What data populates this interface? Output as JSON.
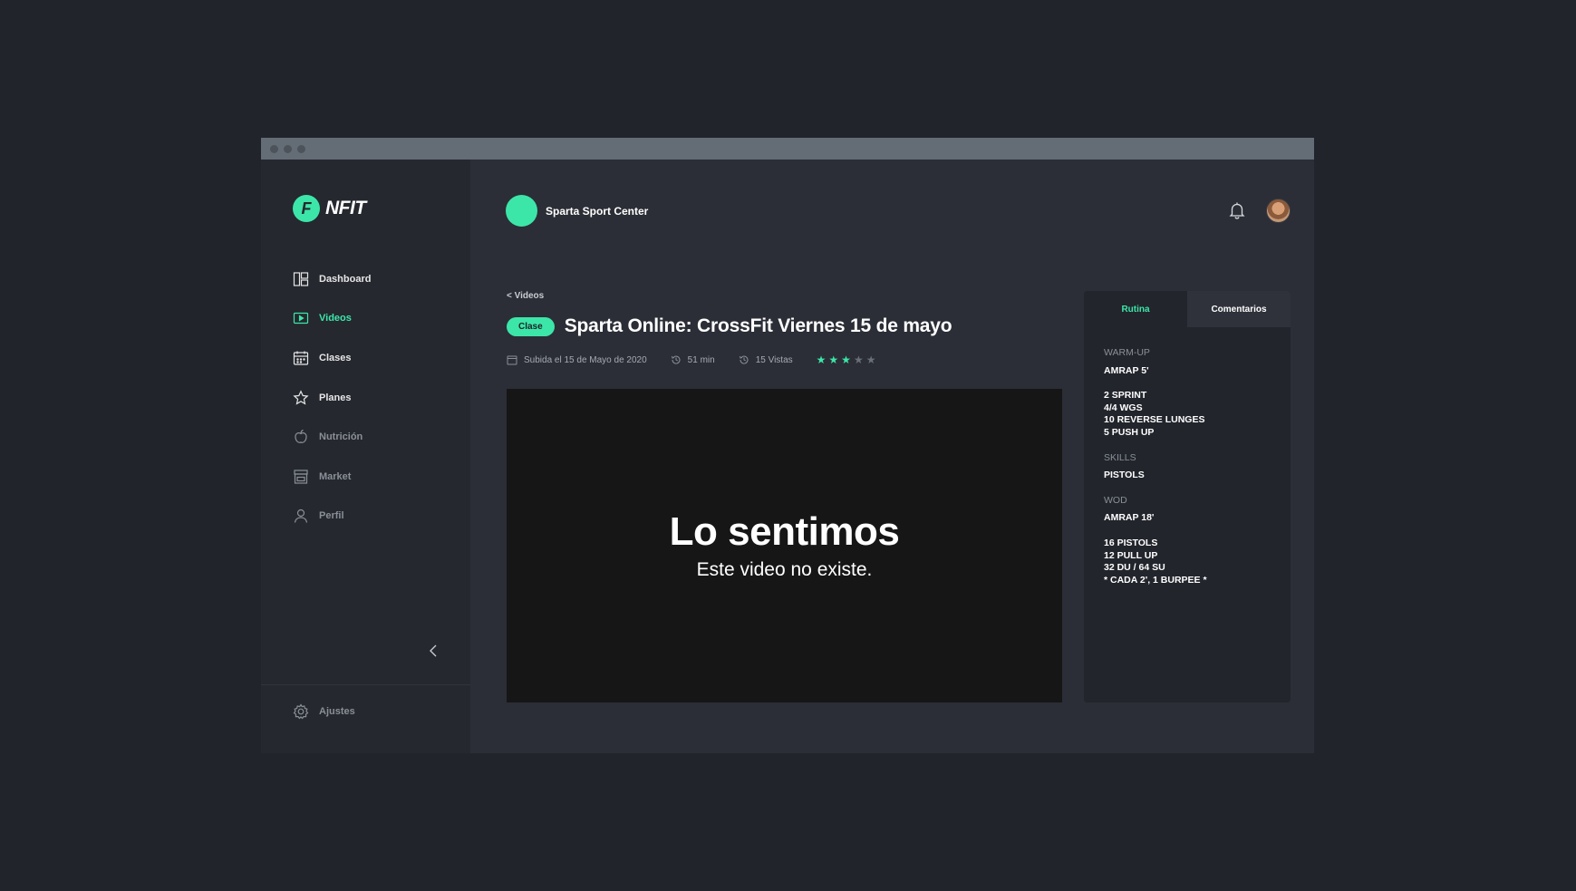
{
  "app": {
    "logo_text": "NFIT",
    "logo_mark": "F"
  },
  "sidebar": {
    "items": [
      {
        "label": "Dashboard",
        "icon": "dashboard-icon"
      },
      {
        "label": "Videos",
        "icon": "video-icon"
      },
      {
        "label": "Clases",
        "icon": "calendar-icon"
      },
      {
        "label": "Planes",
        "icon": "star-icon"
      },
      {
        "label": "Nutrición",
        "icon": "apple-icon"
      },
      {
        "label": "Market",
        "icon": "store-icon"
      },
      {
        "label": "Perfil",
        "icon": "user-icon"
      }
    ],
    "settings_label": "Ajustes"
  },
  "header": {
    "gym_name": "Sparta Sport Center"
  },
  "video": {
    "breadcrumb": "< Videos",
    "badge": "Clase",
    "title": "Sparta Online: CrossFit Viernes 15 de mayo",
    "uploaded": "Subida el 15 de Mayo de 2020",
    "duration": "51 min",
    "views": "15 Vistas",
    "rating": 3,
    "rating_max": 5,
    "error_heading": "Lo sentimos",
    "error_message": "Este video no existe."
  },
  "panel": {
    "tabs": [
      "Rutina",
      "Comentarios"
    ],
    "sections": [
      {
        "label": "WARM-UP",
        "blocks": [
          [
            "AMRAP 5'"
          ],
          [
            "2 SPRINT",
            "4/4 WGS",
            "10 REVERSE LUNGES",
            "5 PUSH UP"
          ]
        ]
      },
      {
        "label": "SKILLS",
        "blocks": [
          [
            "PISTOLS"
          ]
        ]
      },
      {
        "label": "WOD",
        "blocks": [
          [
            "AMRAP 18'"
          ],
          [
            "16 PISTOLS",
            "12 PULL UP",
            "32 DU / 64 SU",
            "* CADA 2', 1 BURPEE *"
          ]
        ]
      }
    ]
  },
  "colors": {
    "accent": "#3ce6a8",
    "background": "#21242b",
    "sidebar": "#25282f",
    "content": "#2b2e36"
  }
}
